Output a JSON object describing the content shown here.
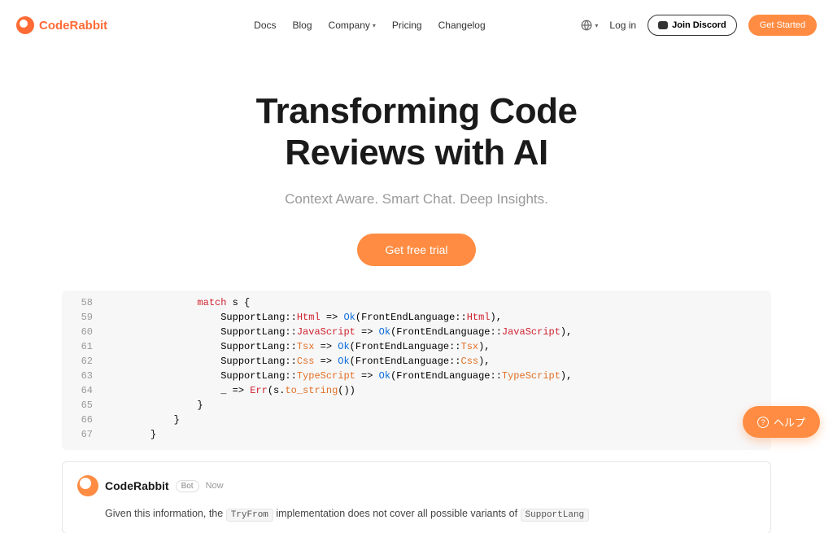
{
  "brand": "CodeRabbit",
  "nav": {
    "docs": "Docs",
    "blog": "Blog",
    "company": "Company",
    "pricing": "Pricing",
    "changelog": "Changelog"
  },
  "header": {
    "login": "Log in",
    "discord": "Join Discord",
    "cta": "Get Started"
  },
  "hero": {
    "title_line1": "Transforming Code",
    "title_line2": "Reviews with AI",
    "subtitle": "Context Aware. Smart Chat. Deep Insights.",
    "cta": "Get free trial"
  },
  "code": {
    "lines": [
      {
        "num": "58",
        "indent": 3,
        "tokens": [
          [
            "kw-match",
            "match"
          ],
          [
            "",
            " s {"
          ]
        ]
      },
      {
        "num": "59",
        "indent": 4,
        "tokens": [
          [
            "",
            "SupportLang::"
          ],
          [
            "kw-html",
            "Html"
          ],
          [
            "",
            " => "
          ],
          [
            "kw-ok",
            "Ok"
          ],
          [
            "",
            "(FrontEndLanguage::"
          ],
          [
            "kw-html",
            "Html"
          ],
          [
            "",
            "),"
          ]
        ]
      },
      {
        "num": "60",
        "indent": 4,
        "tokens": [
          [
            "",
            "SupportLang::"
          ],
          [
            "kw-js",
            "JavaScript"
          ],
          [
            "",
            " => "
          ],
          [
            "kw-ok",
            "Ok"
          ],
          [
            "",
            "(FrontEndLanguage::"
          ],
          [
            "kw-js",
            "JavaScript"
          ],
          [
            "",
            "),"
          ]
        ]
      },
      {
        "num": "61",
        "indent": 4,
        "tokens": [
          [
            "",
            "SupportLang::"
          ],
          [
            "kw-orange",
            "Tsx"
          ],
          [
            "",
            " => "
          ],
          [
            "kw-ok",
            "Ok"
          ],
          [
            "",
            "(FrontEndLanguage::"
          ],
          [
            "kw-orange",
            "Tsx"
          ],
          [
            "",
            "),"
          ]
        ]
      },
      {
        "num": "62",
        "indent": 4,
        "tokens": [
          [
            "",
            "SupportLang::"
          ],
          [
            "kw-orange",
            "Css"
          ],
          [
            "",
            " => "
          ],
          [
            "kw-ok",
            "Ok"
          ],
          [
            "",
            "(FrontEndLanguage::"
          ],
          [
            "kw-orange",
            "Css"
          ],
          [
            "",
            "),"
          ]
        ]
      },
      {
        "num": "63",
        "indent": 4,
        "tokens": [
          [
            "",
            "SupportLang::"
          ],
          [
            "kw-orange",
            "TypeScript"
          ],
          [
            "",
            " => "
          ],
          [
            "kw-ok",
            "Ok"
          ],
          [
            "",
            "(FrontEndLanguage::"
          ],
          [
            "kw-orange",
            "TypeScript"
          ],
          [
            "",
            "),"
          ]
        ]
      },
      {
        "num": "64",
        "indent": 4,
        "tokens": [
          [
            "",
            "_ => "
          ],
          [
            "kw-err",
            "Err"
          ],
          [
            "",
            "(s."
          ],
          [
            "kw-tostr",
            "to_string"
          ],
          [
            "",
            "())"
          ]
        ]
      },
      {
        "num": "65",
        "indent": 3,
        "tokens": [
          [
            "",
            "}"
          ]
        ]
      },
      {
        "num": "66",
        "indent": 2,
        "tokens": [
          [
            "",
            "}"
          ]
        ]
      },
      {
        "num": "67",
        "indent": 1,
        "tokens": [
          [
            "",
            "}"
          ]
        ]
      }
    ]
  },
  "comment": {
    "author": "CodeRabbit",
    "badge": "Bot",
    "time": "Now",
    "body_prefix": "Given this information, the ",
    "body_code1": "TryFrom",
    "body_middle": " implementation does not cover all possible variants of ",
    "body_code2": "SupportLang"
  },
  "help": "ヘルプ"
}
